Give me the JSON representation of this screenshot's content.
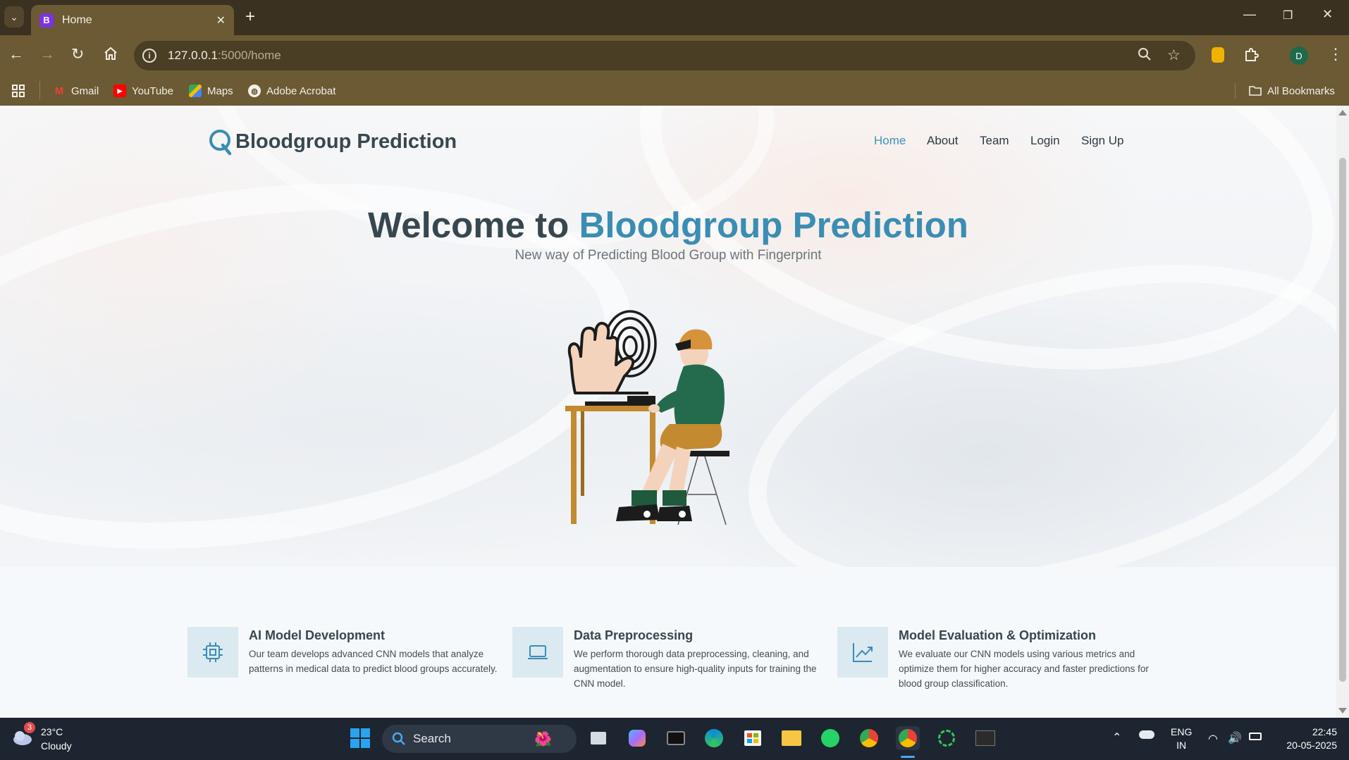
{
  "browser": {
    "tab_title": "Home",
    "tab_favicon": "B",
    "url_host": "127.0.0.1",
    "url_path": ":5000/home",
    "profile_initial": "D",
    "bookmarks": [
      {
        "label": "Gmail",
        "icon": "gmail-icon"
      },
      {
        "label": "YouTube",
        "icon": "youtube-icon"
      },
      {
        "label": "Maps",
        "icon": "maps-icon"
      },
      {
        "label": "Adobe Acrobat",
        "icon": "globe-icon"
      }
    ],
    "all_bookmarks": "All Bookmarks"
  },
  "site": {
    "brand": "Bloodgroup Prediction",
    "nav": [
      "Home",
      "About",
      "Team",
      "Login",
      "Sign Up"
    ],
    "active_nav": "Home",
    "hero_title_prefix": "Welcome to",
    "hero_title_accent": "Bloodgroup Prediction",
    "hero_subtitle": "New way of Predicting Blood Group with Fingerprint",
    "accent_color": "#3a8db3",
    "features": [
      {
        "icon": "cpu-chip-icon",
        "title": "AI Model Development",
        "desc": "Our team develops advanced CNN models that analyze patterns in medical data to predict blood groups accurately."
      },
      {
        "icon": "laptop-icon",
        "title": "Data Preprocessing",
        "desc": "We perform thorough data preprocessing, cleaning, and augmentation to ensure high-quality inputs for training the CNN model."
      },
      {
        "icon": "line-chart-icon",
        "title": "Model Evaluation & Optimization",
        "desc": "We evaluate our CNN models using various metrics and optimize them for higher accuracy and faster predictions for blood group classification."
      }
    ]
  },
  "taskbar": {
    "weather_temp": "23°C",
    "weather_desc": "Cloudy",
    "weather_badge": "3",
    "search_label": "Search",
    "lang_top": "ENG",
    "lang_bottom": "IN",
    "time": "22:45",
    "date": "20-05-2025"
  }
}
